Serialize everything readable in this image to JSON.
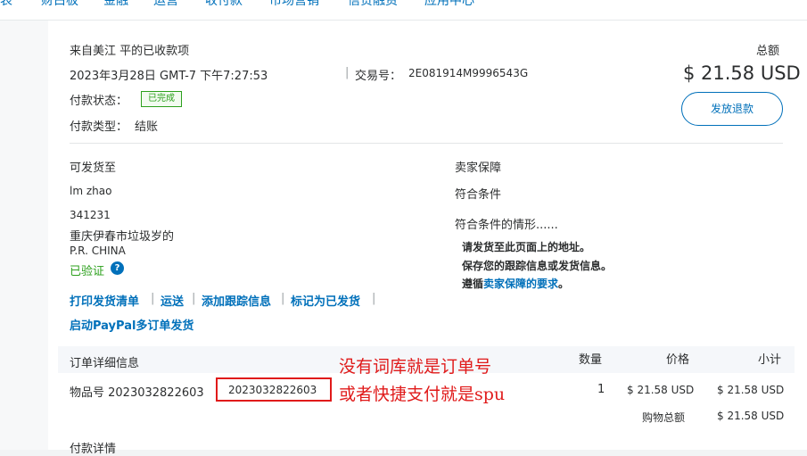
{
  "nav": {
    "items": [
      "表",
      "财白板",
      "金融",
      "运营",
      "收付款",
      "市场营销",
      "信贷融资",
      "应用中心"
    ]
  },
  "transaction": {
    "title": "来自美江 平的已收款项",
    "datetime": "2023年3月28日 GMT-7 下午7:27:53",
    "txn_label": "交易号：",
    "txn_id": "2E081914M9996543G",
    "total_label": "总额",
    "total_amount": "$ 21.58 USD",
    "status_label": "付款状态：",
    "status_value": "已完成",
    "type_label": "付款类型：",
    "type_value": "结账",
    "refund_button": "发放退款"
  },
  "shipping": {
    "heading": "可发货至",
    "name": "lm zhao",
    "postal": "341231",
    "address": "重庆伊春市垃圾岁的",
    "country": "P.R. CHINA",
    "verified": "已验证",
    "help_icon": "?",
    "actions": {
      "print": "打印发货清单",
      "ship": "运送",
      "add_tracking": "添加跟踪信息",
      "mark_shipped": "标记为已发货",
      "multi_order": "启动PayPal多订单发货"
    }
  },
  "seller_protection": {
    "heading": "卖家保障",
    "status": "符合条件",
    "conditions_label": "符合条件的情形......",
    "cond1": "请发货至此页面上的地址。",
    "cond2": "保存您的跟踪信息或发货信息。",
    "cond3_prefix": "遵循",
    "cond3_link": "卖家保障的要求",
    "cond3_suffix": "。"
  },
  "order": {
    "heading": "订单详细信息",
    "col_qty": "数量",
    "col_price": "价格",
    "col_subtotal": "小计",
    "item_label": "物品号 2023032822603",
    "highlighted_code": "2023032822603",
    "qty": "1",
    "price": "$ 21.58 USD",
    "subtotal": "$ 21.58 USD",
    "cart_total_label": "购物总额",
    "cart_total": "$ 21.58 USD",
    "payment_details": "付款详情"
  },
  "annotation": {
    "line1": "没有词库就是订单号",
    "line2": "或者快捷支付就是spu"
  },
  "colors": {
    "accent": "#0070ba",
    "success": "#2ca01c",
    "annotation": "#e01a1a"
  }
}
